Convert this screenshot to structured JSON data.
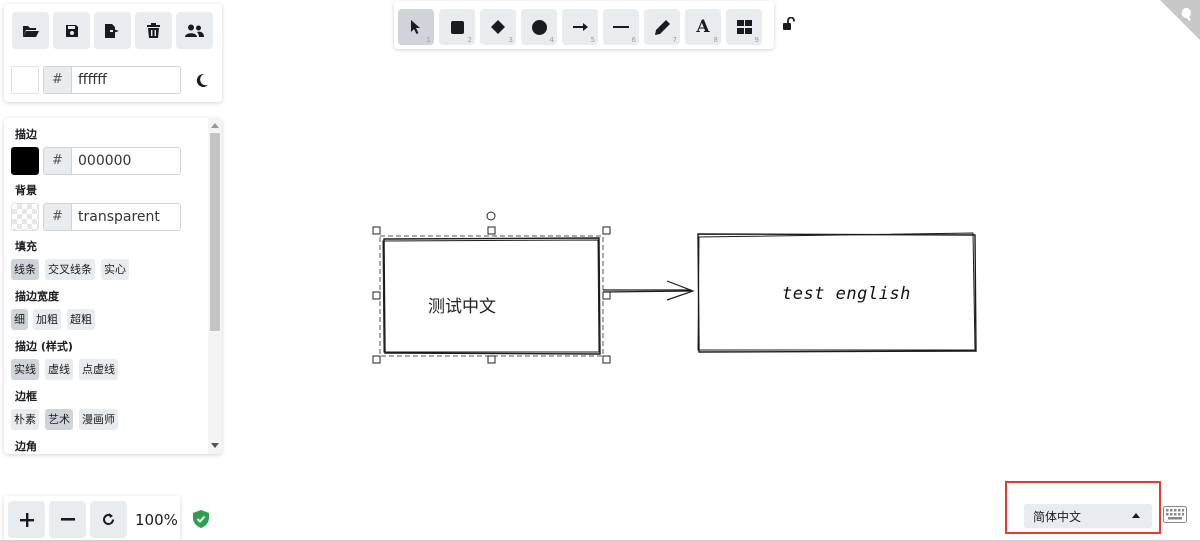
{
  "toolbar_file": {
    "buttons": [
      {
        "icon": "folder-open-icon"
      },
      {
        "icon": "save-icon"
      },
      {
        "icon": "export-icon"
      },
      {
        "icon": "trash-icon"
      },
      {
        "icon": "users-icon"
      }
    ],
    "background_hash": "#",
    "background_value": "ffffff",
    "theme_icon": "moon-icon"
  },
  "properties": {
    "stroke": {
      "label": "描边",
      "hash": "#",
      "value": "000000",
      "color": "#000000"
    },
    "background": {
      "label": "背景",
      "hash": "#",
      "value": "transparent"
    },
    "fill": {
      "label": "填充",
      "options": [
        "线条",
        "交叉线条",
        "实心"
      ],
      "selected": "线条"
    },
    "stroke_width": {
      "label": "描边宽度",
      "options": [
        "细",
        "加粗",
        "超粗"
      ],
      "selected": "细"
    },
    "stroke_style": {
      "label": "描边 (样式)",
      "options": [
        "实线",
        "虚线",
        "点虚线"
      ],
      "selected": "实线"
    },
    "sloppiness": {
      "label": "边框",
      "options": [
        "朴素",
        "艺术",
        "漫画师"
      ],
      "selected": "艺术"
    },
    "edges": {
      "label": "边角"
    }
  },
  "shape_tools": [
    {
      "icon": "pointer-icon",
      "num": "1",
      "active": true
    },
    {
      "icon": "square-icon",
      "num": "2"
    },
    {
      "icon": "diamond-icon",
      "num": "3"
    },
    {
      "icon": "circle-icon",
      "num": "4"
    },
    {
      "icon": "arrow-right-icon",
      "num": "5"
    },
    {
      "icon": "line-icon",
      "num": "6"
    },
    {
      "icon": "pencil-icon",
      "num": "7"
    },
    {
      "icon": "text-icon",
      "label": "A",
      "num": "8"
    },
    {
      "icon": "library-icon",
      "num": "9"
    }
  ],
  "lock_icon": "unlock-icon",
  "canvas": {
    "left_box_text": "测试中文",
    "right_box_text": "test english"
  },
  "zoom": {
    "value": "100%",
    "status_icon": "shield-check-icon"
  },
  "language": {
    "selected": "简体中文",
    "highlight_color": "#e53935"
  },
  "keyboard_icon": "keyboard-icon"
}
